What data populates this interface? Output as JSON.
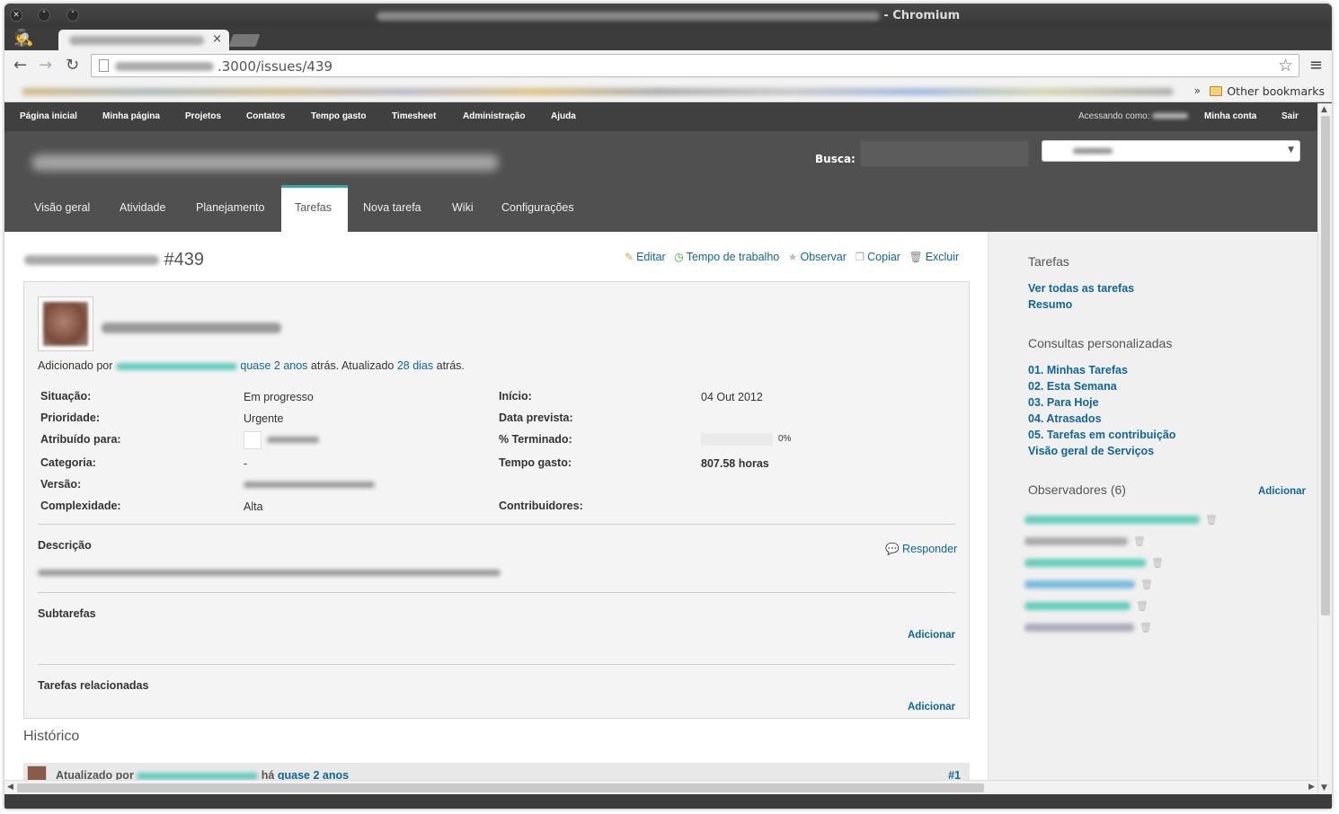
{
  "window": {
    "title_suffix": "- Chromium"
  },
  "tab": {
    "close": "×"
  },
  "toolbar": {
    "url": ".3000/issues/439",
    "back": "←",
    "forward": "→",
    "reload": "↻",
    "star": "☆",
    "menu": "≡"
  },
  "bookmarks": {
    "more": "»",
    "other": "Other bookmarks"
  },
  "topmenu": {
    "items": [
      "Página inicial",
      "Minha página",
      "Projetos",
      "Contatos",
      "Tempo gasto",
      "Timesheet",
      "Administração",
      "Ajuda"
    ],
    "logged_as": "Acessando como:",
    "my_account": "Minha conta",
    "logout": "Sair"
  },
  "header": {
    "search_label": "Busca:"
  },
  "mainmenu": {
    "items": [
      "Visão geral",
      "Atividade",
      "Planejamento",
      "Tarefas",
      "Nova tarefa",
      "Wiki",
      "Configurações"
    ],
    "active": "Tarefas"
  },
  "issue": {
    "number": "#439",
    "actions": {
      "edit": "Editar",
      "log_time": "Tempo de trabalho",
      "watch": "Observar",
      "copy": "Copiar",
      "delete": "Excluir"
    },
    "added_by_prefix": "Adicionado por",
    "added_ago": "quase 2 anos",
    "added_suffix": "atrás. Atualizado",
    "updated_ago": "28 dias",
    "updated_suffix": "atrás.",
    "attributes": {
      "status_label": "Situação:",
      "status": "Em progresso",
      "priority_label": "Prioridade:",
      "priority": "Urgente",
      "assigned_label": "Atribuído para:",
      "category_label": "Categoria:",
      "category": "-",
      "version_label": "Versão:",
      "complexity_label": "Complexidade:",
      "complexity": "Alta",
      "start_label": "Início:",
      "start": "04 Out 2012",
      "due_label": "Data prevista:",
      "done_label": "% Terminado:",
      "done": "0%",
      "spent_label": "Tempo gasto:",
      "spent": "807.58 horas",
      "contrib_label": "Contribuidores:"
    },
    "done_ratio": 0,
    "description_label": "Descrição",
    "reply": "Responder",
    "subtasks_label": "Subtarefas",
    "subtasks_add": "Adicionar",
    "relations_label": "Tarefas relacionadas",
    "relations_add": "Adicionar"
  },
  "history": {
    "title": "Histórico",
    "entry": {
      "prefix": "Atualizado por",
      "middle": "há",
      "ago": "quase 2 anos",
      "num": "#1"
    }
  },
  "sidebar": {
    "issues_title": "Tarefas",
    "issues_links": [
      "Ver todas as tarefas",
      "Resumo"
    ],
    "queries_title": "Consultas personalizadas",
    "queries": [
      "01. Minhas Tarefas",
      "02. Esta Semana",
      "03. Para Hoje",
      "04. Atrasados",
      "05. Tarefas em contribuição",
      "Visão geral de Serviços"
    ],
    "watchers_title": "Observadores (6)",
    "watchers_add": "Adicionar"
  },
  "colors": {
    "link": "#116699",
    "header": "#505050",
    "topmenu": "#404040",
    "active_tab_border": "#33aaaa"
  }
}
